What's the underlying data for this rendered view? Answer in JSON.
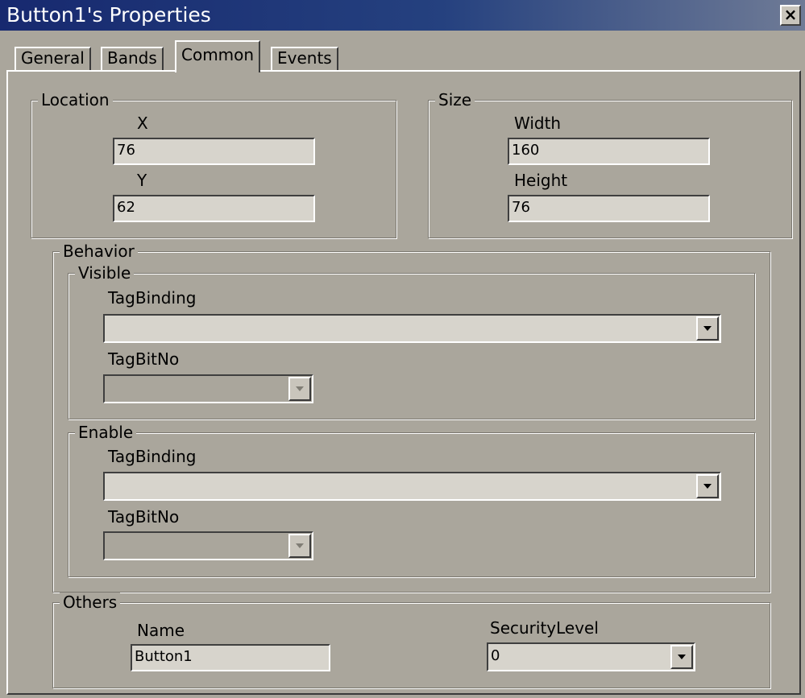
{
  "window": {
    "title": "Button1's Properties",
    "close_glyph": "×"
  },
  "tabs": [
    {
      "label": "General",
      "active": false
    },
    {
      "label": "Bands",
      "active": false
    },
    {
      "label": "Common",
      "active": true
    },
    {
      "label": "Events",
      "active": false
    }
  ],
  "location": {
    "group_label": "Location",
    "x_label": "X",
    "x_value": "76",
    "y_label": "Y",
    "y_value": "62"
  },
  "size": {
    "group_label": "Size",
    "width_label": "Width",
    "width_value": "160",
    "height_label": "Height",
    "height_value": "76"
  },
  "behavior": {
    "group_label": "Behavior",
    "visible": {
      "group_label": "Visible",
      "tagbinding_label": "TagBinding",
      "tagbinding_value": "",
      "tagbitno_label": "TagBitNo",
      "tagbitno_value": ""
    },
    "enable": {
      "group_label": "Enable",
      "tagbinding_label": "TagBinding",
      "tagbinding_value": "",
      "tagbitno_label": "TagBitNo",
      "tagbitno_value": ""
    }
  },
  "others": {
    "group_label": "Others",
    "name_label": "Name",
    "name_value": "Button1",
    "security_label": "SecurityLevel",
    "security_value": "0"
  },
  "colors": {
    "titlebar": "#17296f",
    "dialog_bg": "#aaa69c",
    "field_bg": "#d7d4cc"
  }
}
